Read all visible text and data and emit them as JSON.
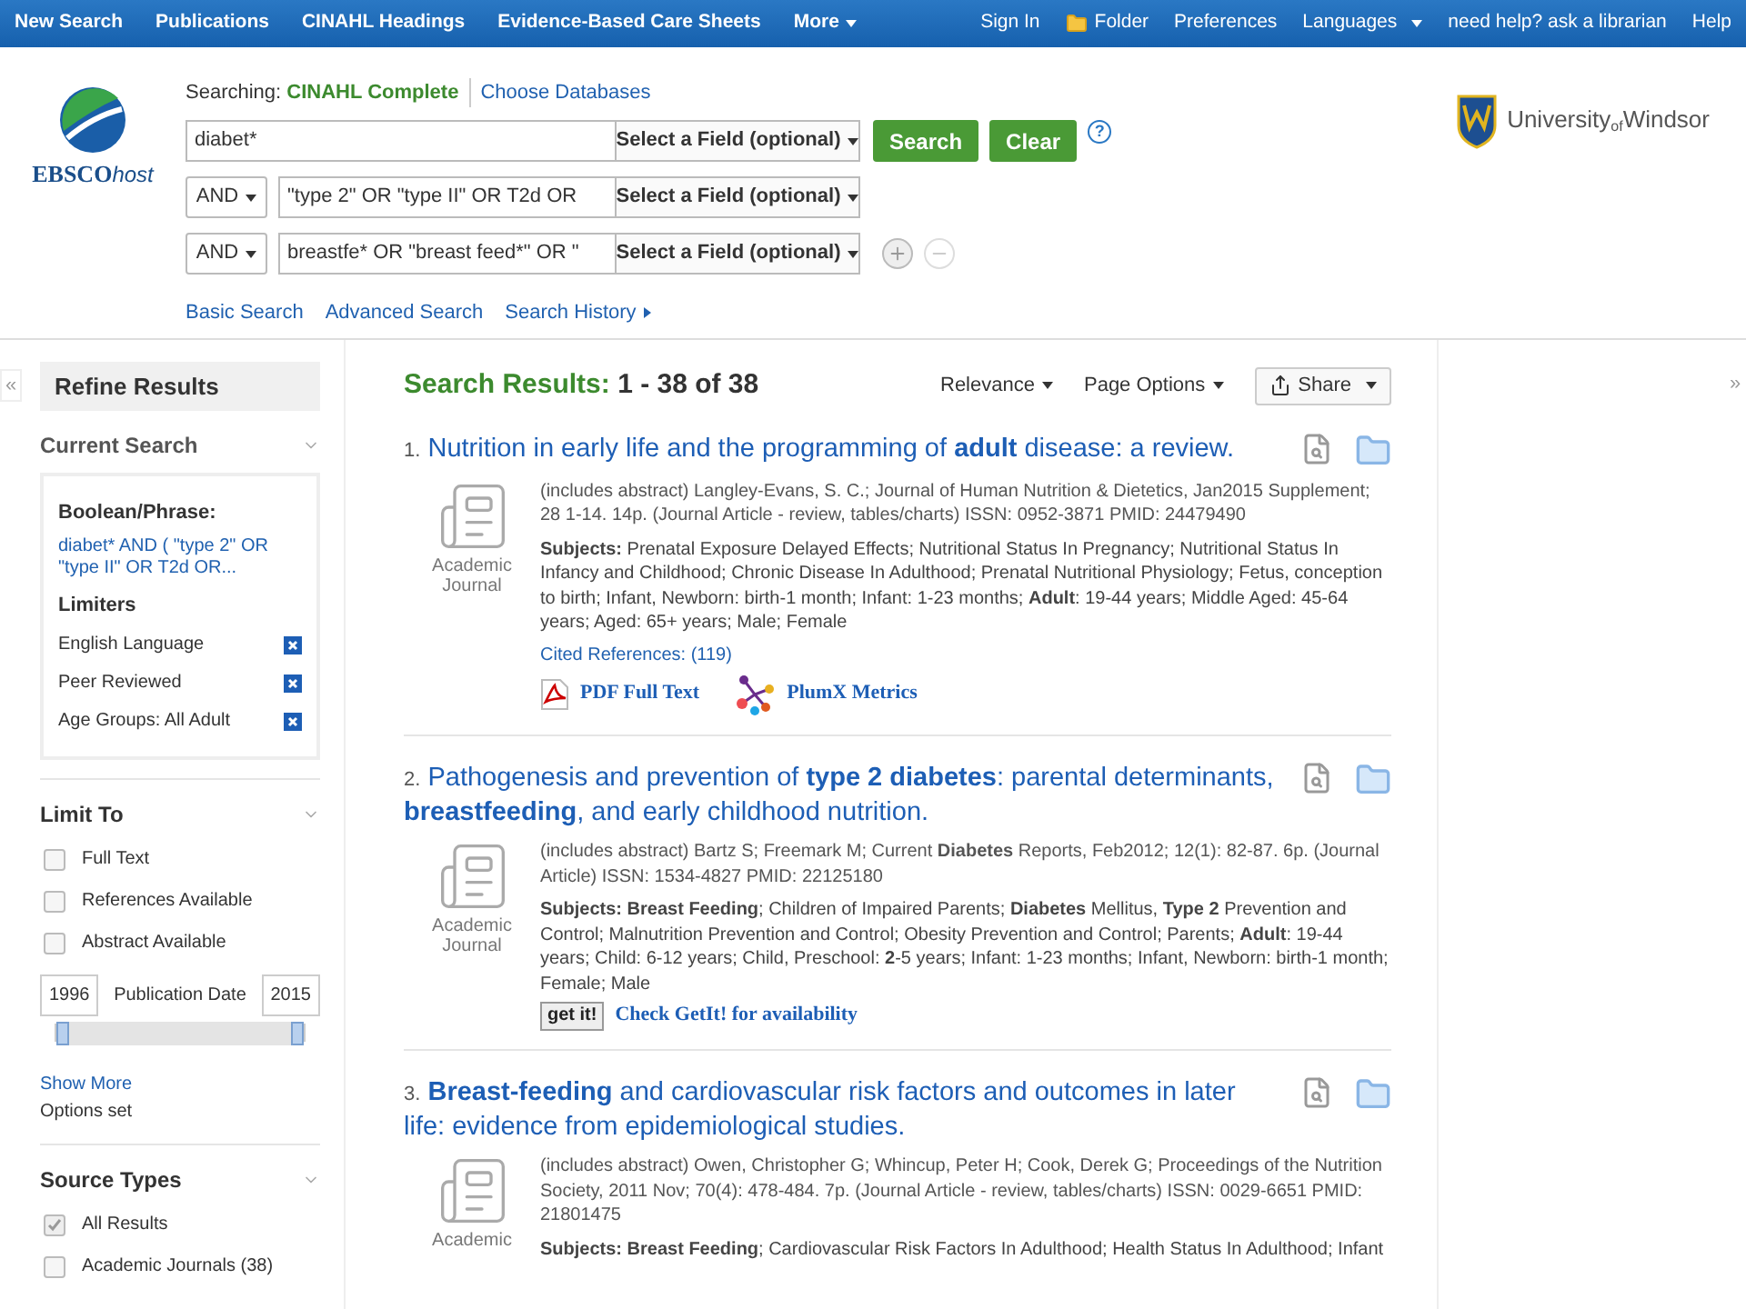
{
  "top_nav": {
    "left": [
      {
        "label": "New Search",
        "dropdown": false
      },
      {
        "label": "Publications",
        "dropdown": false
      },
      {
        "label": "CINAHL Headings",
        "dropdown": false
      },
      {
        "label": "Evidence-Based Care Sheets",
        "dropdown": false
      },
      {
        "label": "More",
        "dropdown": true
      }
    ],
    "right": [
      {
        "label": "Sign In",
        "kind": "link",
        "dropdown": false
      },
      {
        "label": "Folder",
        "kind": "folder",
        "dropdown": false
      },
      {
        "label": "Preferences",
        "kind": "link",
        "dropdown": false
      },
      {
        "label": "Languages",
        "kind": "link",
        "dropdown": true
      },
      {
        "label": "need help? ask a librarian",
        "kind": "link",
        "dropdown": false
      },
      {
        "label": "Help",
        "kind": "link",
        "dropdown": false
      }
    ]
  },
  "header": {
    "logo_text": "EBSCO",
    "logo_suffix": "host",
    "searching_label": "Searching:",
    "database": "CINAHL Complete",
    "choose_databases": "Choose Databases",
    "rows": [
      {
        "operator": "",
        "value": "diabet*",
        "field": "Select a Field (optional)"
      },
      {
        "operator": "AND",
        "value": "\"type 2\" OR \"type II\" OR T2d OR",
        "field": "Select a Field (optional)"
      },
      {
        "operator": "AND",
        "value": "breastfe* OR \"breast feed*\" OR \"",
        "field": "Select a Field (optional)"
      }
    ],
    "search_button": "Search",
    "clear_button": "Clear",
    "help": "?",
    "links": [
      "Basic Search",
      "Advanced Search",
      "Search History"
    ],
    "institution": "University$_{of}$Windsor"
  },
  "sidebar": {
    "collapse": "«",
    "title": "Refine Results",
    "current_search": {
      "heading": "Current Search",
      "boolean_label": "Boolean/Phrase:",
      "boolean_value": "diabet* AND ( \"type 2\" OR \"type II\" OR T2d OR...",
      "limiters_label": "Limiters",
      "limiters": [
        "English Language",
        "Peer Reviewed",
        "Age Groups: All Adult"
      ]
    },
    "limit_to": {
      "heading": "Limit To",
      "options": [
        {
          "label": "Full Text",
          "checked": false
        },
        {
          "label": "References Available",
          "checked": false
        },
        {
          "label": "Abstract Available",
          "checked": false
        }
      ],
      "date_from": "1996",
      "date_label": "Publication Date",
      "date_to": "2015",
      "date_range": {
        "level": 1
      },
      "show_more": "Show More",
      "options_set": "Options set"
    },
    "source_types": {
      "heading": "Source Types",
      "options": [
        {
          "label": "All Results",
          "checked": true
        },
        {
          "label": "Academic Journals (38)",
          "checked": false
        }
      ]
    }
  },
  "results": {
    "label": "Search Results:",
    "range": "1 - 38 of 38",
    "sort": "Relevance",
    "page_options": "Page Options",
    "share": "Share",
    "expand": "»",
    "items": [
      {
        "number": "1.",
        "title": "Nutrition in early life and the programming of **adult** disease: a review.",
        "type": "Academic Journal",
        "citation": "(includes abstract) Langley-Evans, S. C.; Journal of Human Nutrition & Dietetics, Jan2015 Supplement; 28 1-14. 14p. (Journal Article - review, tables/charts) ISSN: 0952-3871 PMID: 24479490",
        "subjects": "**Subjects:** Prenatal Exposure Delayed Effects; Nutritional Status In Pregnancy; Nutritional Status In Infancy and Childhood; Chronic Disease In Adulthood; Prenatal Nutritional Physiology; Fetus, conception to birth; Infant, Newborn: birth-1 month; Infant: 1-23 months; **Adult**: 19-44 years; Middle Aged: 45-64 years; Aged: 65+ years; Male; Female",
        "cited": "Cited References: (119)",
        "links": [
          {
            "kind": "pdf",
            "label": "PDF Full Text"
          },
          {
            "kind": "plumx",
            "label": "PlumX Metrics"
          }
        ]
      },
      {
        "number": "2.",
        "title": "Pathogenesis and prevention of **type 2 diabetes**: parental determinants, **breastfeeding**, and early childhood nutrition.",
        "type": "Academic Journal",
        "citation": "(includes abstract) Bartz S; Freemark M; Current **Diabetes** Reports, Feb2012; 12(1): 82-87. 6p. (Journal Article) ISSN: 1534-4827 PMID: 22125180",
        "subjects": "**Subjects: Breast Feeding**; Children of Impaired Parents; **Diabetes** Mellitus, **Type 2** Prevention and Control; Malnutrition Prevention and Control; Obesity Prevention and Control; Parents; **Adult**: 19-44 years; Child: 6-12 years; Child, Preschool: **2**-5 years; Infant: 1-23 months; Infant, Newborn: birth-1 month; Female; Male",
        "links": [
          {
            "kind": "getit",
            "badge": "get it!",
            "label": "Check GetIt! for availability"
          }
        ]
      },
      {
        "number": "3.",
        "title": "**Breast-feeding** and cardiovascular risk factors and outcomes in later life: evidence from epidemiological studies.",
        "type": "Academic",
        "citation": "(includes abstract) Owen, Christopher G; Whincup, Peter H; Cook, Derek G; Proceedings of the Nutrition Society, 2011 Nov; 70(4): 478-484. 7p. (Journal Article - review, tables/charts) ISSN: 0029-6651 PMID: 21801475",
        "subjects": "**Subjects: Breast Feeding**; Cardiovascular Risk Factors In Adulthood; Health Status In Adulthood; Infant"
      }
    ]
  }
}
